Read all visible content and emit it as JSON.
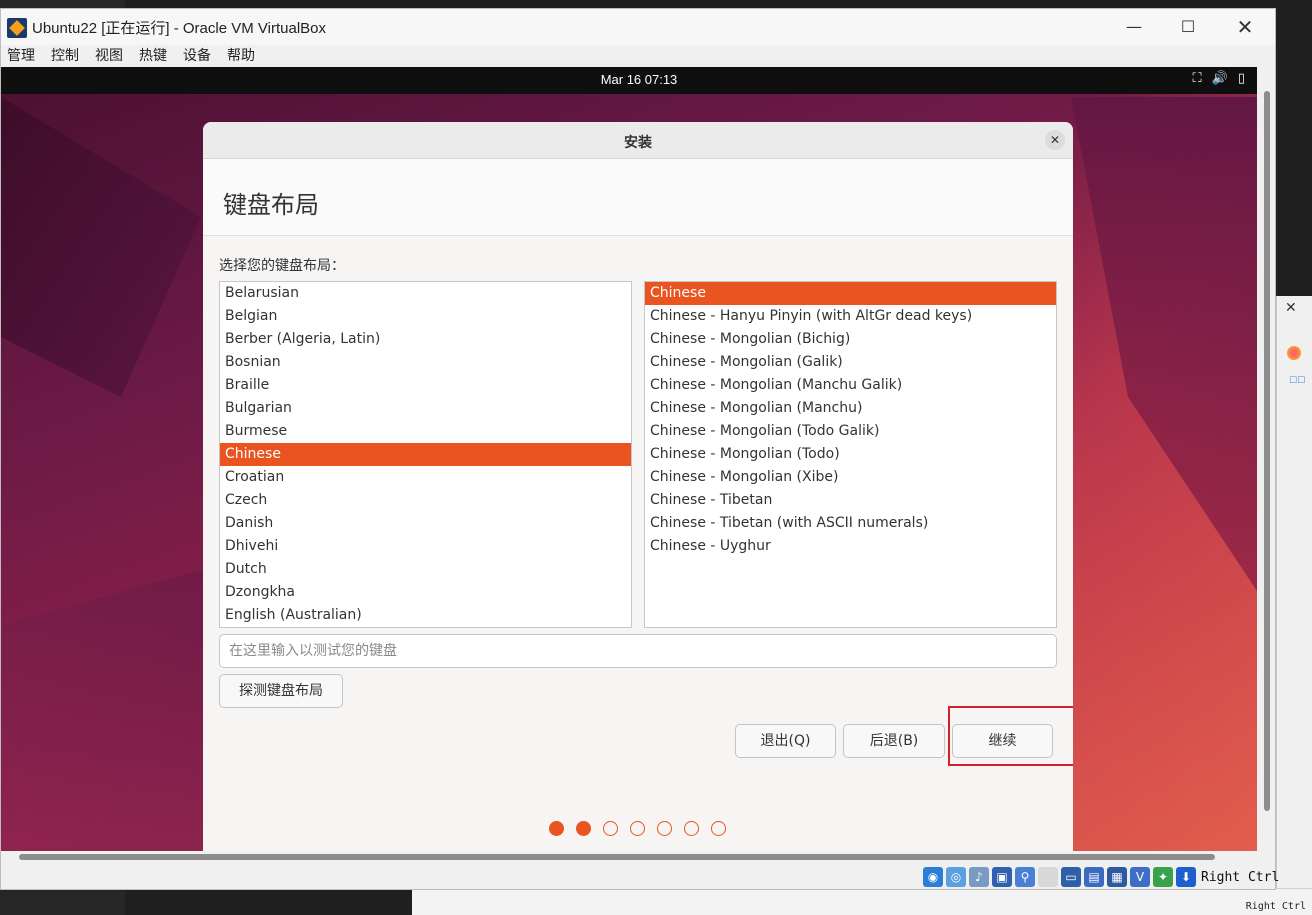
{
  "window": {
    "title": "Ubuntu22 [正在运行] - Oracle VM VirtualBox",
    "minimize": "—",
    "maximize": "☐",
    "close": "✕"
  },
  "menu": [
    "管理",
    "控制",
    "视图",
    "热键",
    "设备",
    "帮助"
  ],
  "guest_topbar": {
    "clock": "Mar 16  07:13",
    "tray": "⛶🔊▯"
  },
  "dialog": {
    "title": "安装",
    "close": "✕",
    "page_title": "键盘布局",
    "prompt": "选择您的键盘布局：",
    "languages": [
      "Belarusian",
      "Belgian",
      "Berber (Algeria, Latin)",
      "Bosnian",
      "Braille",
      "Bulgarian",
      "Burmese",
      "Chinese",
      "Croatian",
      "Czech",
      "Danish",
      "Dhivehi",
      "Dutch",
      "Dzongkha",
      "English (Australian)"
    ],
    "selected_language": "Chinese",
    "variants": [
      "Chinese",
      "Chinese - Hanyu Pinyin (with AltGr dead keys)",
      "Chinese - Mongolian (Bichig)",
      "Chinese - Mongolian (Galik)",
      "Chinese - Mongolian (Manchu Galik)",
      "Chinese - Mongolian (Manchu)",
      "Chinese - Mongolian (Todo Galik)",
      "Chinese - Mongolian (Todo)",
      "Chinese - Mongolian (Xibe)",
      "Chinese - Tibetan",
      "Chinese - Tibetan (with ASCII numerals)",
      "Chinese - Uyghur"
    ],
    "selected_variant": "Chinese",
    "test_placeholder": "在这里输入以测试您的键盘",
    "detect_button": "探测键盘布局",
    "quit_button": "退出(Q)",
    "back_button": "后退(B)",
    "continue_button": "继续",
    "progress": {
      "total_steps": 7,
      "completed_steps": 2
    }
  },
  "statusbar": {
    "host_key": "Right Ctrl",
    "icons": [
      "hdd-icon",
      "optical-icon",
      "audio-icon",
      "network-icon",
      "usb-icon",
      "shared-folder-icon",
      "display-icon",
      "recording-icon",
      "cpu-icon",
      "vt-icon",
      "mouse-integration-icon",
      "keyboard-capture-icon"
    ]
  },
  "host_background": {
    "tray_text": "Right Ctrl",
    "panel_close": "✕",
    "panel_icon_label": "☐☐"
  },
  "colors": {
    "accent": "#e95420",
    "highlight_box": "#d0202a"
  }
}
